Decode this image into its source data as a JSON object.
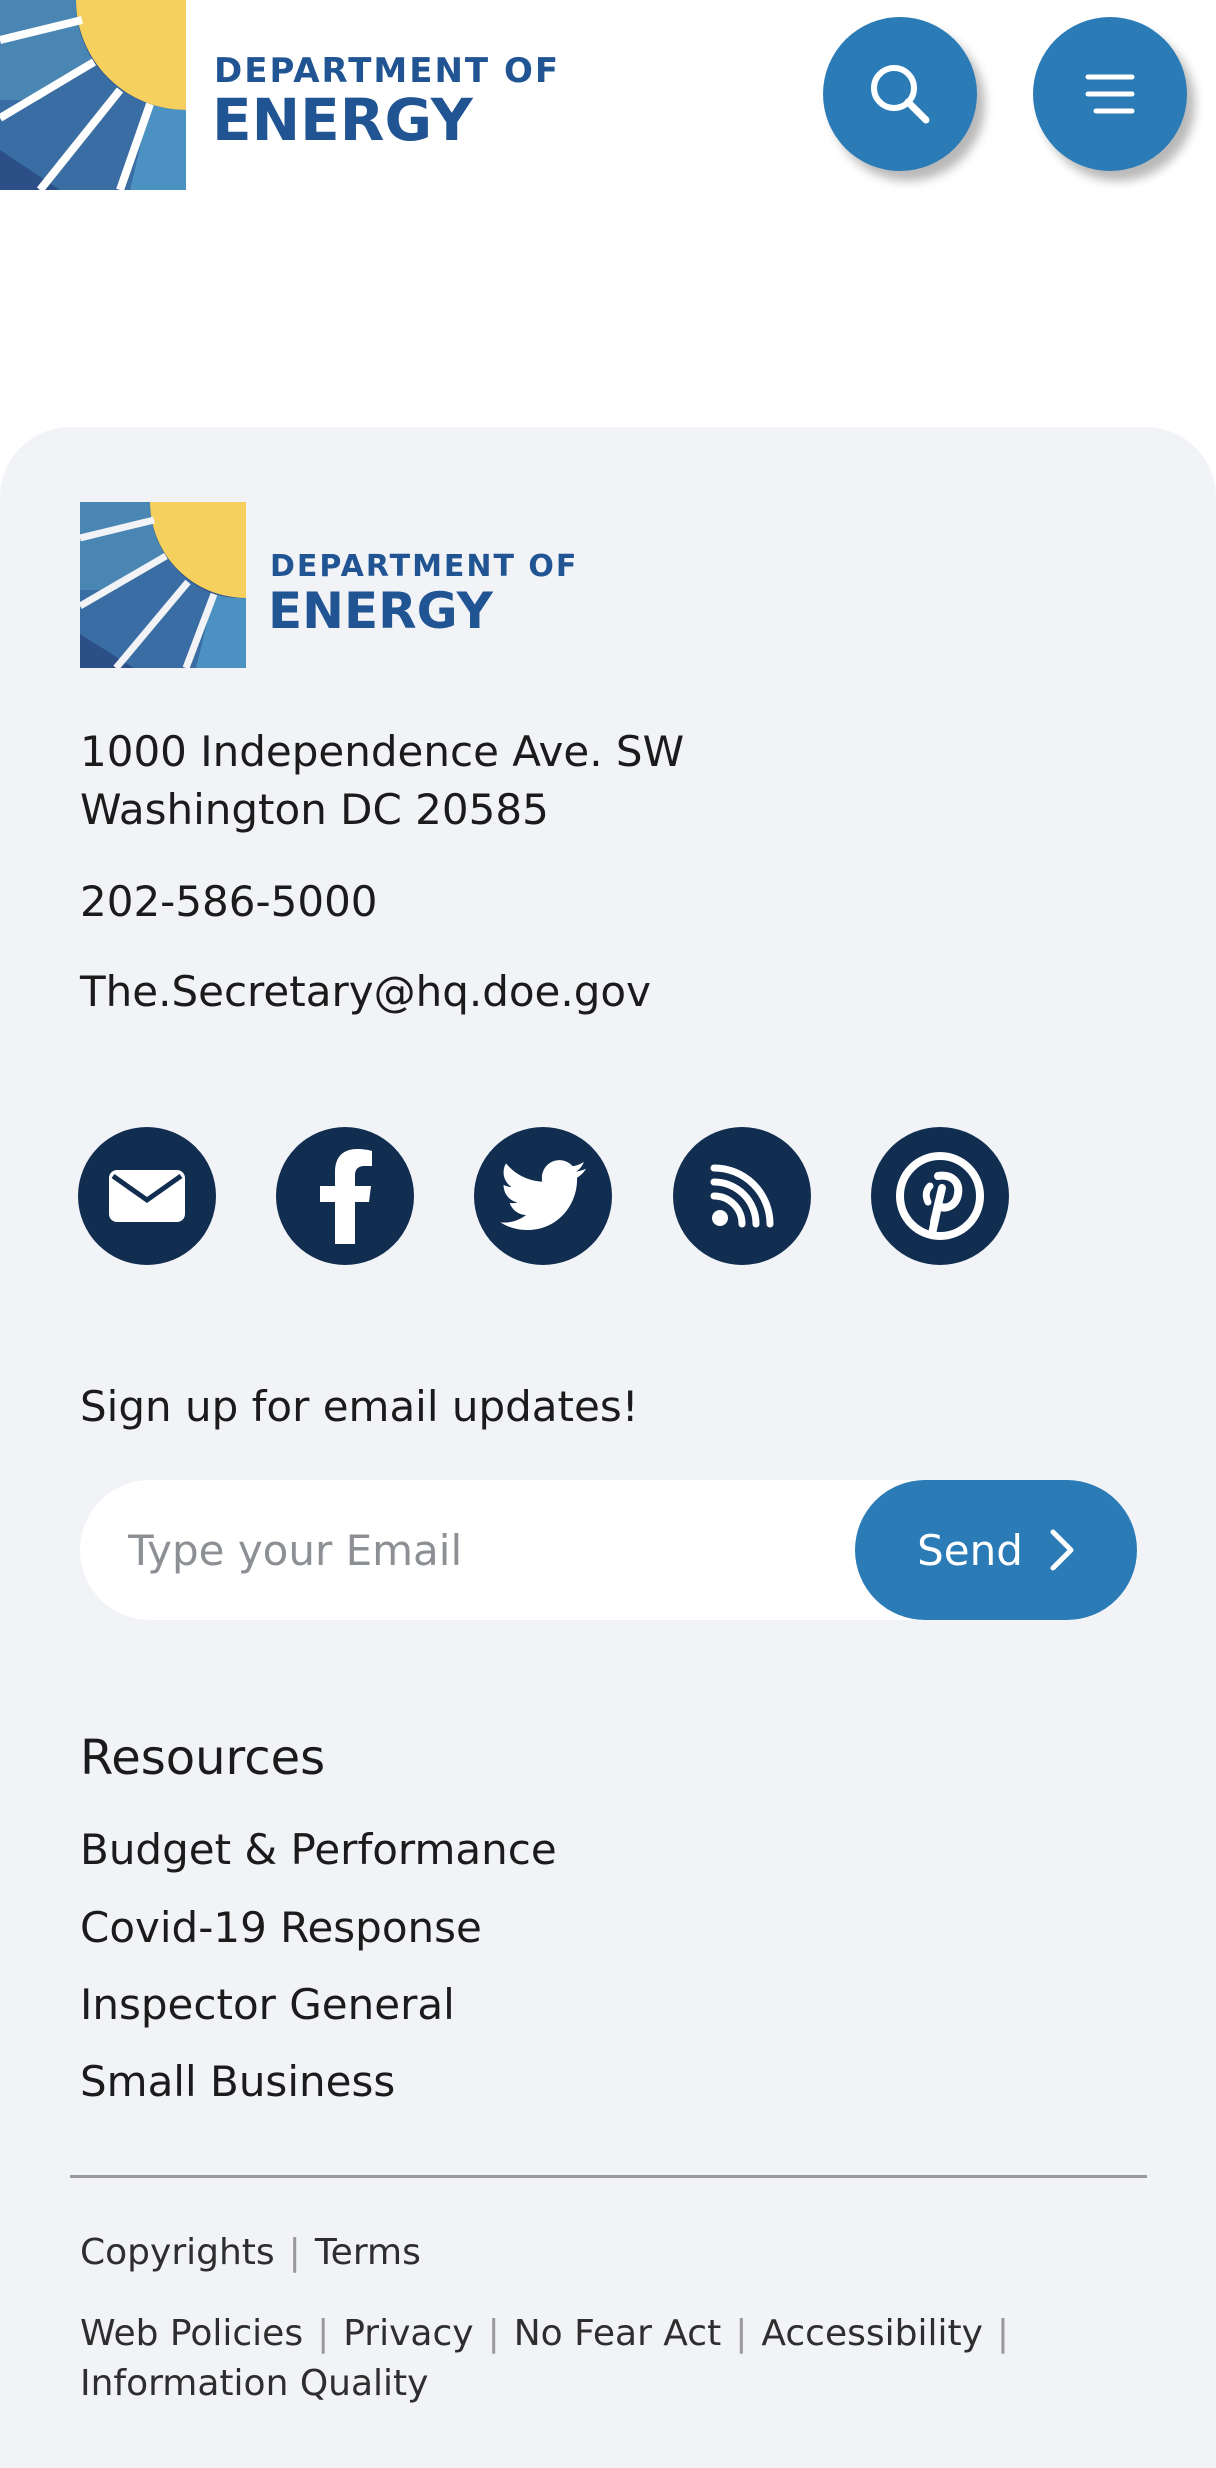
{
  "brand": {
    "logo_line1": "DEPARTMENT OF",
    "logo_line2": "ENERGY",
    "colors": {
      "primary_blue": "#2b7bb7",
      "navy": "#112e51",
      "logo_text": "#205493",
      "logo_yellow": "#f5d05f",
      "footer_bg": "#f1f3f6"
    }
  },
  "header": {
    "search_icon": "search-icon",
    "menu_icon": "hamburger-menu-icon"
  },
  "footer": {
    "address_line1": "1000 Independence Ave. SW",
    "address_line2": "Washington DC 20585",
    "phone": "202-586-5000",
    "email": "The.Secretary@hq.doe.gov",
    "social_icons": [
      "email-icon",
      "facebook-icon",
      "twitter-icon",
      "rss-icon",
      "pinterest-icon"
    ],
    "signup": {
      "label": "Sign up for email updates!",
      "placeholder": "Type your Email",
      "button_label": "Send"
    },
    "resources": {
      "heading": "Resources",
      "links": [
        "Budget & Performance",
        "Covid-19 Response",
        "Inspector General",
        "Small Business"
      ]
    },
    "legal": {
      "row1": [
        "Copyrights",
        "Terms"
      ],
      "row2": [
        "Web Policies",
        "Privacy",
        "No Fear Act",
        "Accessibility"
      ],
      "row3": [
        "Information Quality"
      ]
    }
  }
}
